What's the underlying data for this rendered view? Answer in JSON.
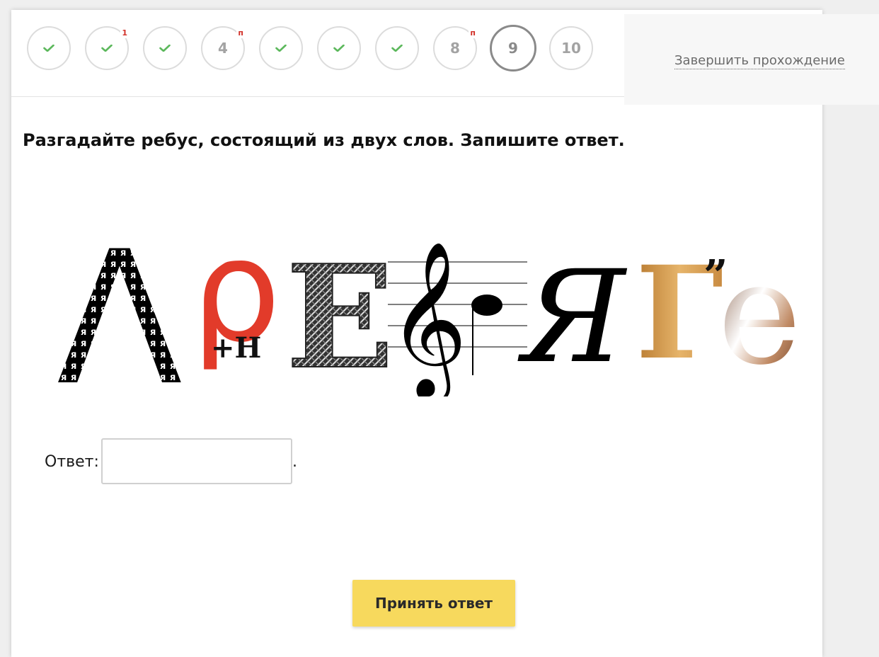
{
  "navigation": {
    "items": [
      {
        "label": "",
        "state": "done",
        "badge": ""
      },
      {
        "label": "",
        "state": "done",
        "badge": "1"
      },
      {
        "label": "",
        "state": "done",
        "badge": ""
      },
      {
        "label": "4",
        "state": "pending",
        "badge": "п"
      },
      {
        "label": "",
        "state": "done",
        "badge": ""
      },
      {
        "label": "",
        "state": "done",
        "badge": ""
      },
      {
        "label": "",
        "state": "done",
        "badge": ""
      },
      {
        "label": "8",
        "state": "pending",
        "badge": "п"
      },
      {
        "label": "9",
        "state": "current",
        "badge": ""
      },
      {
        "label": "10",
        "state": "pending",
        "badge": ""
      }
    ],
    "finish_label": "Завершить прохождение"
  },
  "question": {
    "title": "Разгадайте ребус, состоящий из двух слов. Запишите ответ."
  },
  "rebus": {
    "glyphs": {
      "lambda": "Λ",
      "rho": "ρ",
      "plus_n": "+Н",
      "e_letter": "Е",
      "treble_clef": "𝄞",
      "ya": "Я",
      "g_letter": "Г",
      "commas": "”",
      "e_small": "е"
    }
  },
  "answer": {
    "label": "Ответ:",
    "value": "",
    "placeholder": "",
    "suffix": "."
  },
  "submit": {
    "label": "Принять ответ"
  },
  "colors": {
    "check": "#5cb85c",
    "badge": "#d2322a",
    "rho": "#e23b2a",
    "button": "#f7d95d",
    "g_gold": "#d8a150",
    "e_brown": "#8b5a3c"
  }
}
